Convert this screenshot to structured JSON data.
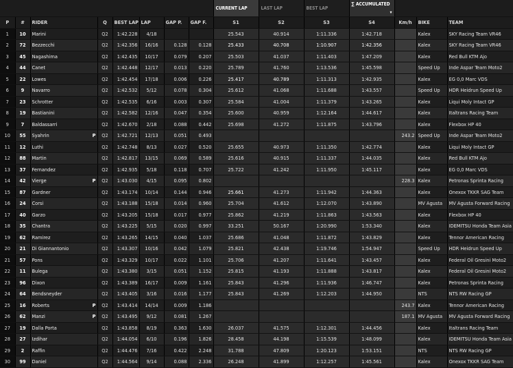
{
  "headers": {
    "pos": "P",
    "num": "#",
    "rider": "RIDER",
    "cls": "Q",
    "best": "BEST LAP",
    "lap": "LAP",
    "gapp": "GAP P.",
    "gapf": "GAP F.",
    "s1": "S1",
    "s2": "S2",
    "s3": "S3",
    "s4": "S4",
    "speed": "Km/h",
    "bike": "BIKE",
    "team": "TEAM"
  },
  "tabs": {
    "current": "CURRENT LAP",
    "last": "LAST LAP",
    "best": "BEST LAP",
    "accumulated": "ACCUMULATED",
    "acc_prefix": "∑"
  },
  "rows": [
    {
      "pos": "1",
      "num": "10",
      "rider": "Marini",
      "flag": "",
      "cls": "Q2",
      "best": "1:42.228",
      "lap": "4/18",
      "gapp": "",
      "gapf": "",
      "s1": "25.543",
      "s2": "40.914",
      "s3": "1:11.336",
      "s4": "1:42.718",
      "speed": "",
      "bike": "Kalex",
      "team": "SKY Racing Team VR46"
    },
    {
      "pos": "2",
      "num": "72",
      "rider": "Bezzecchi",
      "flag": "",
      "cls": "Q2",
      "best": "1:42.356",
      "lap": "16/16",
      "gapp": "0.128",
      "gapf": "0.128",
      "s1": "25.433",
      "s2": "40.708",
      "s3": "1:10.907",
      "s4": "1:42.356",
      "speed": "",
      "bike": "Kalex",
      "team": "SKY Racing Team VR46"
    },
    {
      "pos": "3",
      "num": "45",
      "rider": "Nagashima",
      "flag": "",
      "cls": "Q2",
      "best": "1:42.435",
      "lap": "10/17",
      "gapp": "0.079",
      "gapf": "0.207",
      "s1": "25.503",
      "s2": "41.037",
      "s3": "1:11.403",
      "s4": "1:47.209",
      "speed": "",
      "bike": "Kalex",
      "team": "Red Bull KTM Ajo"
    },
    {
      "pos": "4",
      "num": "44",
      "rider": "Canet",
      "flag": "",
      "cls": "Q2",
      "best": "1:42.448",
      "lap": "12/17",
      "gapp": "0.013",
      "gapf": "0.220",
      "s1": "25.789",
      "s2": "41.760",
      "s3": "1:13.536",
      "s4": "1:45.598",
      "speed": "",
      "bike": "Speed Up",
      "team": "Inde Aspar Team Moto2"
    },
    {
      "pos": "5",
      "num": "22",
      "rider": "Lowes",
      "flag": "",
      "cls": "Q2",
      "best": "1:42.454",
      "lap": "17/18",
      "gapp": "0.006",
      "gapf": "0.226",
      "s1": "25.417",
      "s2": "40.789",
      "s3": "1:11.313",
      "s4": "1:42.935",
      "speed": "",
      "bike": "Kalex",
      "team": "EG 0,0 Marc VDS"
    },
    {
      "pos": "6",
      "num": "9",
      "rider": "Navarro",
      "flag": "",
      "cls": "Q2",
      "best": "1:42.532",
      "lap": "5/12",
      "gapp": "0.078",
      "gapf": "0.304",
      "s1": "25.612",
      "s2": "41.068",
      "s3": "1:11.688",
      "s4": "1:43.557",
      "speed": "",
      "bike": "Speed Up",
      "team": "HDR Heidrun Speed Up"
    },
    {
      "pos": "7",
      "num": "23",
      "rider": "Schrotter",
      "flag": "",
      "cls": "Q2",
      "best": "1:42.535",
      "lap": "6/16",
      "gapp": "0.003",
      "gapf": "0.307",
      "s1": "25.584",
      "s2": "41.004",
      "s3": "1:11.379",
      "s4": "1:43.265",
      "speed": "",
      "bike": "Kalex",
      "team": "Liqui Moly Intact GP"
    },
    {
      "pos": "8",
      "num": "19",
      "rider": "Bastianini",
      "flag": "",
      "cls": "Q2",
      "best": "1:42.582",
      "lap": "12/16",
      "gapp": "0.047",
      "gapf": "0.354",
      "s1": "25.600",
      "s2": "40.959",
      "s3": "1:12.164",
      "s4": "1:44.617",
      "speed": "",
      "bike": "Kalex",
      "team": "Italtrans Racing Team"
    },
    {
      "pos": "9",
      "num": "7",
      "rider": "Baldassarri",
      "flag": "",
      "cls": "Q2",
      "best": "1:42.670",
      "lap": "2/18",
      "gapp": "0.088",
      "gapf": "0.442",
      "s1": "25.698",
      "s2": "41.272",
      "s3": "1:11.875",
      "s4": "1:43.796",
      "speed": "",
      "bike": "Kalex",
      "team": "Flexbox HP 40"
    },
    {
      "pos": "10",
      "num": "55",
      "rider": "Syahrin",
      "flag": "P",
      "cls": "Q2",
      "best": "1:42.721",
      "lap": "12/13",
      "gapp": "0.051",
      "gapf": "0.493",
      "s1": "",
      "s2": "",
      "s3": "",
      "s4": "",
      "speed": "243.2",
      "bike": "Speed Up",
      "team": "Inde Aspar Team Moto2"
    },
    {
      "pos": "11",
      "num": "12",
      "rider": "Luthi",
      "flag": "",
      "cls": "Q2",
      "best": "1:42.748",
      "lap": "8/13",
      "gapp": "0.027",
      "gapf": "0.520",
      "s1": "25.655",
      "s2": "40.973",
      "s3": "1:11.350",
      "s4": "1:42.774",
      "speed": "",
      "bike": "Kalex",
      "team": "Liqui Moly Intact GP"
    },
    {
      "pos": "12",
      "num": "88",
      "rider": "Martin",
      "flag": "",
      "cls": "Q2",
      "best": "1:42.817",
      "lap": "13/15",
      "gapp": "0.069",
      "gapf": "0.589",
      "s1": "25.616",
      "s2": "40.915",
      "s3": "1:11.337",
      "s4": "1:44.035",
      "speed": "",
      "bike": "Kalex",
      "team": "Red Bull KTM Ajo"
    },
    {
      "pos": "13",
      "num": "37",
      "rider": "Fernandez",
      "flag": "",
      "cls": "Q2",
      "best": "1:42.935",
      "lap": "5/18",
      "gapp": "0.118",
      "gapf": "0.707",
      "s1": "25.722",
      "s2": "41.242",
      "s3": "1:11.950",
      "s4": "1:45.117",
      "speed": "",
      "bike": "Kalex",
      "team": "EG 0,0 Marc VDS"
    },
    {
      "pos": "14",
      "num": "42",
      "rider": "Vierge",
      "flag": "P",
      "cls": "Q2",
      "best": "1:43.030",
      "lap": "4/15",
      "gapp": "0.095",
      "gapf": "0.802",
      "s1": "",
      "s2": "",
      "s3": "",
      "s4": "",
      "speed": "228.3",
      "bike": "Kalex",
      "team": "Petronas Sprinta Racing"
    },
    {
      "pos": "15",
      "num": "87",
      "rider": "Gardner",
      "flag": "",
      "cls": "Q2",
      "best": "1:43.174",
      "lap": "10/14",
      "gapp": "0.144",
      "gapf": "0.946",
      "s1": "25.661",
      "s2": "41.273",
      "s3": "1:11.942",
      "s4": "1:44.363",
      "speed": "",
      "bike": "Kalex",
      "team": "Onexox TKKR SAG Team"
    },
    {
      "pos": "16",
      "num": "24",
      "rider": "Corsi",
      "flag": "",
      "cls": "Q2",
      "best": "1:43.188",
      "lap": "15/18",
      "gapp": "0.014",
      "gapf": "0.960",
      "s1": "25.704",
      "s2": "41.612",
      "s3": "1:12.070",
      "s4": "1:43.890",
      "speed": "",
      "bike": "MV Agusta",
      "team": "MV Agusta Forward Racing"
    },
    {
      "pos": "17",
      "num": "40",
      "rider": "Garzo",
      "flag": "",
      "cls": "Q2",
      "best": "1:43.205",
      "lap": "15/18",
      "gapp": "0.017",
      "gapf": "0.977",
      "s1": "25.862",
      "s2": "41.219",
      "s3": "1:11.863",
      "s4": "1:43.563",
      "speed": "",
      "bike": "Kalex",
      "team": "Flexbox HP 40"
    },
    {
      "pos": "18",
      "num": "35",
      "rider": "Chantra",
      "flag": "",
      "cls": "Q2",
      "best": "1:43.225",
      "lap": "5/15",
      "gapp": "0.020",
      "gapf": "0.997",
      "s1": "33.251",
      "s2": "50.167",
      "s3": "1:20.990",
      "s4": "1:53.340",
      "speed": "",
      "bike": "Kalex",
      "team": "IDEMITSU Honda Team Asia"
    },
    {
      "pos": "19",
      "num": "62",
      "rider": "Ramirez",
      "flag": "",
      "cls": "Q2",
      "best": "1:43.265",
      "lap": "14/15",
      "gapp": "0.040",
      "gapf": "1.037",
      "s1": "25.686",
      "s2": "41.048",
      "s3": "1:11.872",
      "s4": "1:43.829",
      "speed": "",
      "bike": "Kalex",
      "team": "Tennor American Racing"
    },
    {
      "pos": "20",
      "num": "21",
      "rider": "Di Giannantonio",
      "flag": "",
      "cls": "Q2",
      "best": "1:43.307",
      "lap": "10/16",
      "gapp": "0.042",
      "gapf": "1.079",
      "s1": "25.821",
      "s2": "42.438",
      "s3": "1:19.746",
      "s4": "1:54.947",
      "speed": "",
      "bike": "Speed Up",
      "team": "HDR Heidrun Speed Up"
    },
    {
      "pos": "21",
      "num": "57",
      "rider": "Pons",
      "flag": "",
      "cls": "Q2",
      "best": "1:43.329",
      "lap": "10/17",
      "gapp": "0.022",
      "gapf": "1.101",
      "s1": "25.706",
      "s2": "41.207",
      "s3": "1:11.641",
      "s4": "1:43.457",
      "speed": "",
      "bike": "Kalex",
      "team": "Federal Oil Gresini Moto2"
    },
    {
      "pos": "22",
      "num": "11",
      "rider": "Bulega",
      "flag": "",
      "cls": "Q2",
      "best": "1:43.380",
      "lap": "3/15",
      "gapp": "0.051",
      "gapf": "1.152",
      "s1": "25.815",
      "s2": "41.193",
      "s3": "1:11.888",
      "s4": "1:43.817",
      "speed": "",
      "bike": "Kalex",
      "team": "Federal Oil Gresini Moto2"
    },
    {
      "pos": "23",
      "num": "96",
      "rider": "Dixon",
      "flag": "",
      "cls": "Q2",
      "best": "1:43.389",
      "lap": "16/17",
      "gapp": "0.009",
      "gapf": "1.161",
      "s1": "25.843",
      "s2": "41.296",
      "s3": "1:11.936",
      "s4": "1:46.747",
      "speed": "",
      "bike": "Kalex",
      "team": "Petronas Sprinta Racing"
    },
    {
      "pos": "24",
      "num": "64",
      "rider": "Bendsneyder",
      "flag": "",
      "cls": "Q2",
      "best": "1:43.405",
      "lap": "3/16",
      "gapp": "0.016",
      "gapf": "1.177",
      "s1": "25.843",
      "s2": "41.269",
      "s3": "1:12.203",
      "s4": "1:44.950",
      "speed": "",
      "bike": "NTS",
      "team": "NTS RW Racing GP"
    },
    {
      "pos": "25",
      "num": "16",
      "rider": "Roberts",
      "flag": "P",
      "cls": "Q2",
      "best": "1:43.414",
      "lap": "14/14",
      "gapp": "0.009",
      "gapf": "1.186",
      "s1": "",
      "s2": "",
      "s3": "",
      "s4": "",
      "speed": "243.7",
      "bike": "Kalex",
      "team": "Tennor American Racing"
    },
    {
      "pos": "26",
      "num": "62",
      "rider": "Manzi",
      "flag": "P",
      "cls": "Q2",
      "best": "1:43.495",
      "lap": "9/12",
      "gapp": "0.081",
      "gapf": "1.267",
      "s1": "",
      "s2": "",
      "s3": "",
      "s4": "",
      "speed": "187.1",
      "bike": "MV Agusta",
      "team": "MV Agusta Forward Racing"
    },
    {
      "pos": "27",
      "num": "19",
      "rider": "Dalla Porta",
      "flag": "",
      "cls": "Q2",
      "best": "1:43.858",
      "lap": "8/19",
      "gapp": "0.363",
      "gapf": "1.630",
      "s1": "26.037",
      "s2": "41.575",
      "s3": "1:12.301",
      "s4": "1:44.456",
      "speed": "",
      "bike": "Kalex",
      "team": "Italtrans Racing Team"
    },
    {
      "pos": "28",
      "num": "27",
      "rider": "Izdihar",
      "flag": "",
      "cls": "Q2",
      "best": "1:44.054",
      "lap": "6/10",
      "gapp": "0.196",
      "gapf": "1.826",
      "s1": "28.458",
      "s2": "44.198",
      "s3": "1:15.539",
      "s4": "1:48.099",
      "speed": "",
      "bike": "Kalex",
      "team": "IDEMITSU Honda Team Asia"
    },
    {
      "pos": "29",
      "num": "2",
      "rider": "Raffin",
      "flag": "",
      "cls": "Q2",
      "best": "1:44.476",
      "lap": "7/16",
      "gapp": "0.422",
      "gapf": "2.248",
      "s1": "31.788",
      "s2": "47.809",
      "s3": "1:20.123",
      "s4": "1:53.151",
      "speed": "",
      "bike": "NTS",
      "team": "NTS RW Racing GP"
    },
    {
      "pos": "30",
      "num": "99",
      "rider": "Daniel",
      "flag": "",
      "cls": "Q2",
      "best": "1:44.564",
      "lap": "9/14",
      "gapp": "0.088",
      "gapf": "2.336",
      "s1": "26.248",
      "s2": "41.899",
      "s3": "1:12.257",
      "s4": "1:45.561",
      "speed": "",
      "bike": "Kalex",
      "team": "Onexox TKKR SAG Team"
    }
  ],
  "highlights": {
    "row1_s1": "#c62a16",
    "row1_s2": "#c62a16",
    "row1_s3": "#c62a16",
    "row1_s4": "#e07b16",
    "row4_s1": "#e07b16",
    "row4_s2": "#e07b16",
    "row14_s1": "#e07b16"
  }
}
